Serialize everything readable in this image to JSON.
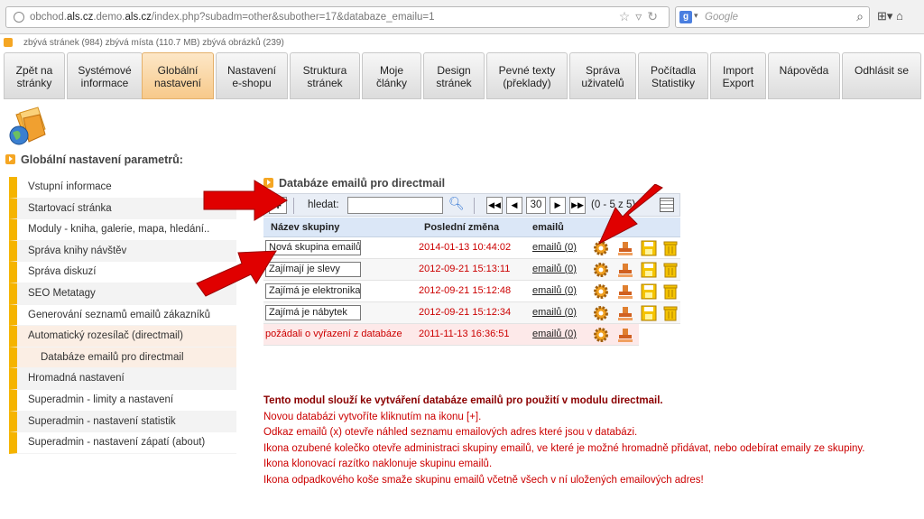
{
  "browser": {
    "url_prefix": "obchod.",
    "url_domain": "als.cz",
    "url_mid": ".demo.",
    "url_domain2": "als.cz",
    "url_suffix": "/index.php?subadm=other&subother=17&databaze_emailu=1",
    "search_placeholder": "Google"
  },
  "stats": {
    "text": "zbývá stránek (984)   zbývá místa (110.7 MB)   zbývá obrázků (239)"
  },
  "nav": {
    "tabs": [
      {
        "label": "Zpět na\nstránky"
      },
      {
        "label": "Systémové\ninformace"
      },
      {
        "label": "Globální\nnastavení"
      },
      {
        "label": "Nastavení\ne-shopu"
      },
      {
        "label": "Struktura\nstránek"
      },
      {
        "label": "Moje\nčlánky"
      },
      {
        "label": "Design\nstránek"
      },
      {
        "label": "Pevné texty\n(překlady)"
      },
      {
        "label": "Správa\nuživatelů"
      },
      {
        "label": "Počítadla\nStatistiky"
      },
      {
        "label": "Import\nExport"
      },
      {
        "label": "Nápověda"
      },
      {
        "label": "Odhlásit se"
      }
    ]
  },
  "page_title": "Globální nastavení parametrů:",
  "sidebar": {
    "items": [
      {
        "label": "Vstupní informace"
      },
      {
        "label": "Startovací stránka"
      },
      {
        "label": "Moduly - kniha, galerie, mapa, hledání.."
      },
      {
        "label": "Správa knihy návštěv"
      },
      {
        "label": "Správa diskuzí"
      },
      {
        "label": "SEO Metatagy"
      },
      {
        "label": "Generování seznamů emailů zákazníků"
      },
      {
        "label": "Automatický rozesílač (directmail)"
      },
      {
        "label": "Databáze emailů pro directmail"
      },
      {
        "label": "Hromadná nastavení"
      },
      {
        "label": "Superadmin - limity a nastavení"
      },
      {
        "label": "Superadmin - nastavení statistik"
      },
      {
        "label": "Superadmin - nastavení zápatí (about)"
      }
    ]
  },
  "main": {
    "section_title": "Databáze emailů pro directmail",
    "toolbar": {
      "add_label": "+",
      "search_label": "hledat:",
      "page_value": "30",
      "page_info": "(0 - 5 z 5)"
    },
    "table": {
      "headers": [
        "Název skupiny",
        "Poslední změna",
        "emailů"
      ],
      "rows": [
        {
          "name": "Nová skupina emailů",
          "date": "2014-01-13 10:44:02",
          "emails": "emailů (0)"
        },
        {
          "name": "Zajímají je slevy",
          "date": "2012-09-21 15:13:11",
          "emails": "emailů (0)"
        },
        {
          "name": "Zajímá je elektronika",
          "date": "2012-09-21 15:12:48",
          "emails": "emailů (0)"
        },
        {
          "name": "Zajímá je nábytek",
          "date": "2012-09-21 15:12:34",
          "emails": "emailů (0)"
        },
        {
          "name": "požádali o vyřazení z databáze",
          "date": "2011-11-13 16:36:51",
          "emails": "emailů (0)"
        }
      ]
    }
  },
  "info": {
    "title": "Tento modul slouží ke vytváření databáze emailů pro použití v modulu directmail.",
    "lines": [
      "Novou databázi vytvoříte kliknutím na ikonu [+].",
      "Odkaz emailů (x) otevře náhled seznamu emailových adres které jsou v databázi.",
      "Ikona ozubené kolečko otevře administraci skupiny emailů, ve které je možné hromadně přidávat, nebo odebírat emaily ze skupiny.",
      "Ikona klonovací razítko naklonuje skupinu emailů.",
      "Ikona odpadkového koše smaže skupinu emailů včetně všech v ní uložených emailových adres!"
    ]
  },
  "colors": {
    "accent": "#f5b400",
    "active_tab": "#f7c98a",
    "table_header": "#dbe7f7",
    "red_text": "#cc0000"
  }
}
